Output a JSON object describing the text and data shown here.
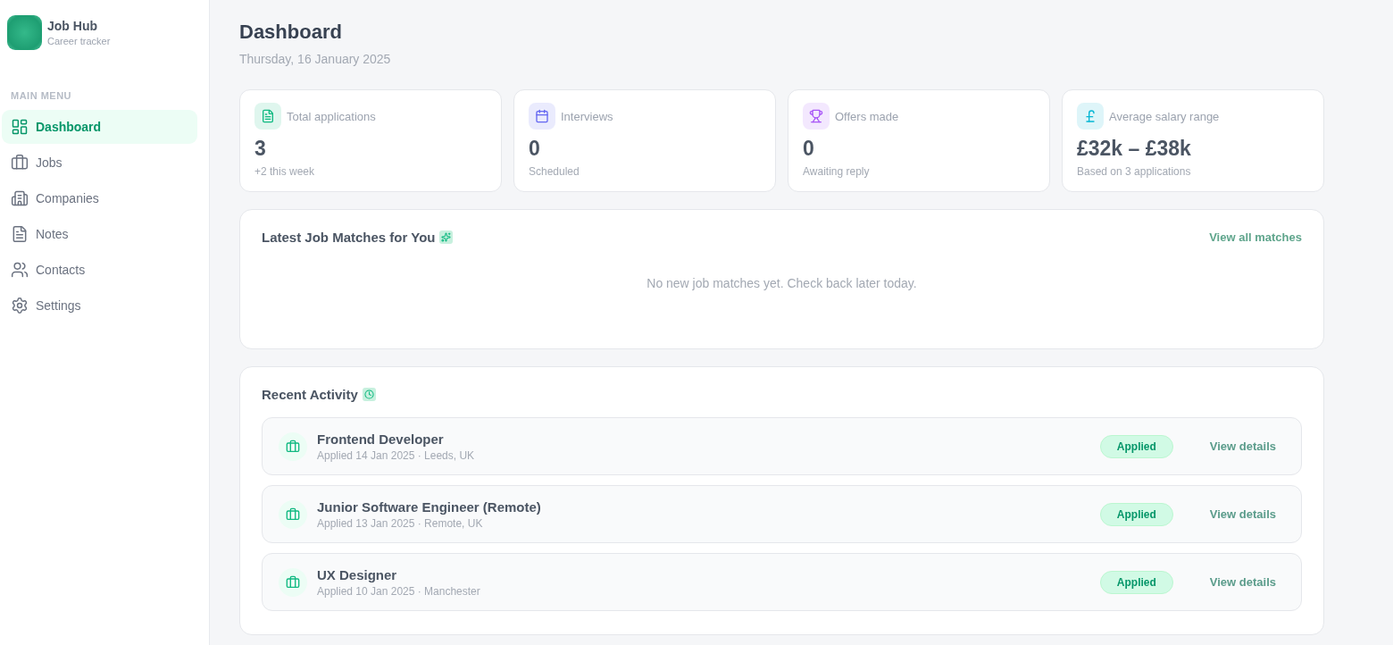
{
  "sidebar": {
    "app_name": "Job Hub",
    "app_tagline": "Career tracker",
    "section_label": "MAIN MENU",
    "items": [
      {
        "label": "Dashboard",
        "selected": true
      },
      {
        "label": "Jobs",
        "selected": false
      },
      {
        "label": "Companies",
        "selected": false
      },
      {
        "label": "Notes",
        "selected": false
      },
      {
        "label": "Contacts",
        "selected": false
      },
      {
        "label": "Settings",
        "selected": false
      }
    ]
  },
  "header": {
    "title": "Dashboard",
    "date": "Thursday, 16 January 2025"
  },
  "stats": [
    {
      "label": "Total applications",
      "value": "3",
      "note": "+2 this week",
      "color": "#10b981"
    },
    {
      "label": "Interviews",
      "value": "0",
      "note": "Scheduled",
      "color": "#6366f1"
    },
    {
      "label": "Offers made",
      "value": "0",
      "note": "Awaiting reply",
      "color": "#a855f7"
    },
    {
      "label": "Average salary range",
      "value": "£32k – £38k",
      "note": "Based on 3 applications",
      "color": "#06b6d4"
    }
  ],
  "alerts": {
    "title": "Latest Job Matches for You",
    "link": "View all matches",
    "empty_text": "No new job matches yet. Check back later today."
  },
  "recent": {
    "title": "Recent Activity",
    "rows": [
      {
        "title": "Frontend Developer",
        "subtitle": "Applied 14 Jan 2025 · Leeds, UK",
        "status": "Applied",
        "action": "View details"
      },
      {
        "title": "Junior Software Engineer (Remote)",
        "subtitle": "Applied 13 Jan 2025 · Remote, UK",
        "status": "Applied",
        "action": "View details"
      },
      {
        "title": "UX Designer",
        "subtitle": "Applied 10 Jan 2025 · Manchester",
        "status": "Applied",
        "action": "View details"
      }
    ]
  }
}
